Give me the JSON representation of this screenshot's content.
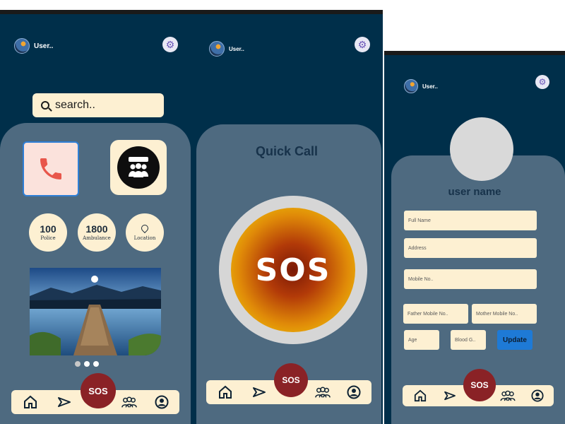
{
  "screen_home": {
    "user_label": "User..",
    "search_placeholder": "search..",
    "quick_dials": [
      {
        "number": "100",
        "label": "Police"
      },
      {
        "number": "1800",
        "label": "Ambulance"
      },
      {
        "label": "Location"
      }
    ],
    "carousel": {
      "total": 3,
      "active": 2
    },
    "fab_label": "SOS"
  },
  "screen_quick_call": {
    "user_label": "User..",
    "title": "Quick Call",
    "sos_big_label": "SOS",
    "fab_label": "SOS"
  },
  "screen_profile": {
    "user_label": "User..",
    "username": "user name",
    "fields": {
      "full_name": "Full Name",
      "address": "Address",
      "mobile": "Mobile No..",
      "father_mobile": "Father Mobile No..",
      "mother_mobile": "Mother Mobile No..",
      "age": "Age",
      "blood_group": "Blood G.."
    },
    "update_label": "Update",
    "fab_label": "SOS"
  },
  "nav_icons": [
    "home-icon",
    "send-icon",
    "sos-button",
    "group-icon",
    "profile-icon"
  ],
  "colors": {
    "background": "#002f4a",
    "panel": "#4e6a80",
    "cream": "#fdf0d2",
    "sos_red": "#8a2226",
    "update_blue": "#1e7ad6"
  }
}
